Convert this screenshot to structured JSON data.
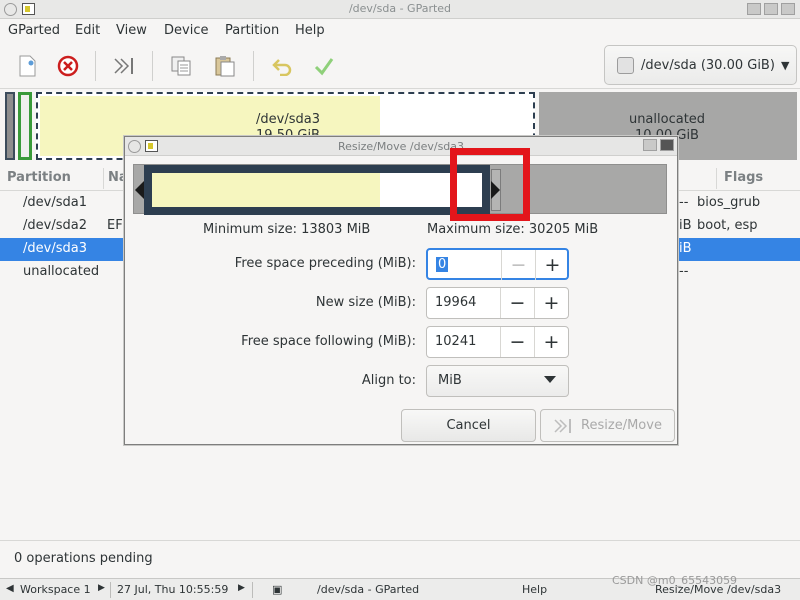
{
  "window": {
    "title": "/dev/sda - GParted"
  },
  "menu": [
    "GParted",
    "Edit",
    "View",
    "Device",
    "Partition",
    "Help"
  ],
  "device_selector": {
    "label": "/dev/sda (30.00 GiB)"
  },
  "map": {
    "sda3": {
      "name": "/dev/sda3",
      "size": "19.50 GiB"
    },
    "unallocated": {
      "name": "unallocated",
      "size": "10.00 GiB"
    }
  },
  "table": {
    "columns": [
      "Partition",
      "Na",
      "Flags"
    ],
    "rows": [
      {
        "partition": "/dev/sda1",
        "name": "",
        "tail": "--",
        "flags": "bios_grub"
      },
      {
        "partition": "/dev/sda2",
        "name": "EF",
        "tail": "iB",
        "flags": "boot, esp"
      },
      {
        "partition": "/dev/sda3",
        "name": "",
        "tail": "iB",
        "flags": ""
      },
      {
        "partition": "unallocated",
        "name": "",
        "tail": "--",
        "flags": ""
      }
    ]
  },
  "status": {
    "operations": "0 operations pending"
  },
  "taskbar": {
    "workspace": "Workspace 1",
    "datetime": "27 Jul, Thu 10:55:59",
    "task_window": "/dev/sda - GParted",
    "help": "Help",
    "task_dialog": "Resize/Move /dev/sda3",
    "watermark": "CSDN @m0_65543059"
  },
  "dialog": {
    "title": "Resize/Move /dev/sda3",
    "min_size": "Minimum size: 13803 MiB",
    "max_size": "Maximum size: 30205 MiB",
    "fields": {
      "preceding": {
        "label": "Free space preceding (MiB):",
        "value": "0"
      },
      "new_size": {
        "label": "New size (MiB):",
        "value": "19964"
      },
      "following": {
        "label": "Free space following (MiB):",
        "value": "10241"
      }
    },
    "align": {
      "label": "Align to:",
      "value": "MiB"
    },
    "buttons": {
      "cancel": "Cancel",
      "resize": "Resize/Move"
    }
  },
  "icons": {
    "new": "new-icon",
    "delete": "delete-icon",
    "resize": "resize-move-icon",
    "copy": "copy-icon",
    "paste": "paste-icon",
    "undo": "undo-icon",
    "apply": "apply-icon"
  },
  "colors": {
    "selection": "#3584e4",
    "used_space": "#f6f6bf",
    "unallocated": "#a7a7a6",
    "partition_border": "#2d3e50",
    "highlight": "#e3161b"
  }
}
